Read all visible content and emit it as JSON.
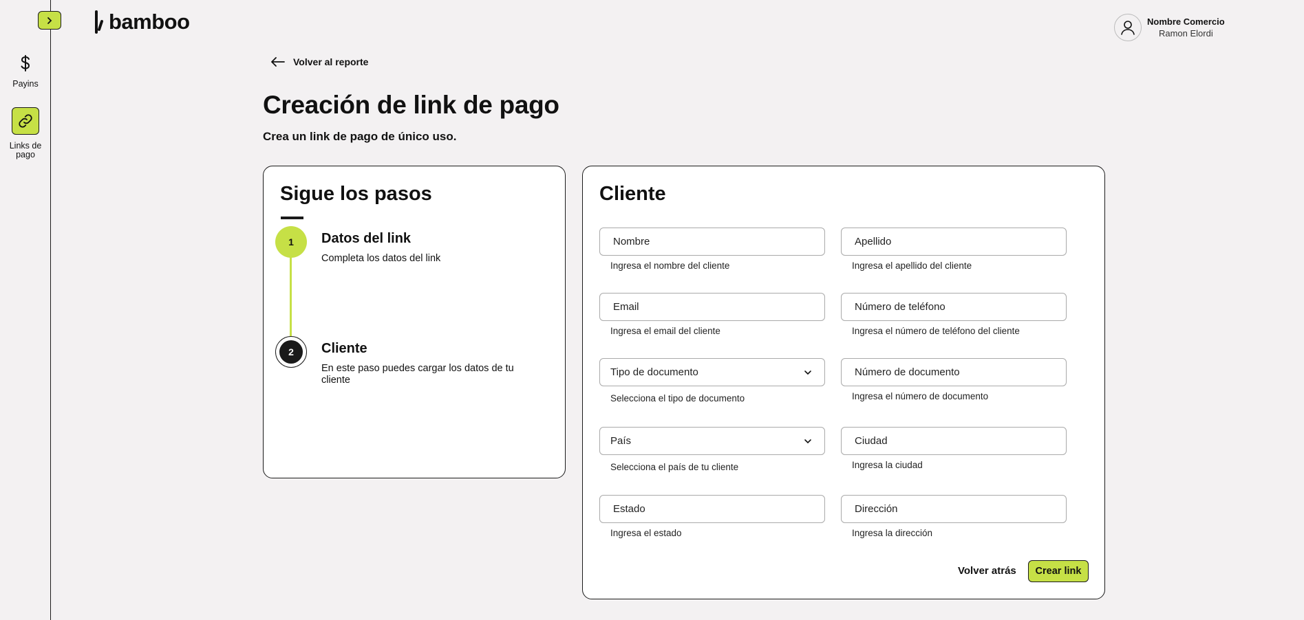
{
  "sidebar": {
    "toggle_icon": "chevron-right-icon",
    "items": [
      {
        "label": "Payins",
        "icon": "dollar-icon"
      },
      {
        "label": "Links de pago",
        "icon": "link-icon"
      }
    ]
  },
  "header": {
    "logo_text": "bamboo",
    "user": {
      "company": "Nombre Comercio",
      "name": "Ramon Elordi",
      "icon": "user-icon"
    }
  },
  "nav": {
    "back_label": "Volver al reporte"
  },
  "page": {
    "title": "Creación de link de pago",
    "subtitle": "Crea un link de pago de único uso."
  },
  "steps": {
    "title": "Sigue los pasos",
    "items": [
      {
        "number": "1",
        "title": "Datos del link",
        "description": "Completa los datos del link"
      },
      {
        "number": "2",
        "title": "Cliente",
        "description": "En este paso puedes cargar los datos de tu cliente"
      }
    ]
  },
  "client_form": {
    "title": "Cliente",
    "fields": [
      {
        "label": "Nombre",
        "hint": "Ingresa el nombre del cliente"
      },
      {
        "label": "Apellido",
        "hint": "Ingresa el apellido del cliente"
      },
      {
        "label": "Email",
        "hint": "Ingresa el email del cliente"
      },
      {
        "label": "Número de teléfono",
        "hint": "Ingresa el número de teléfono del cliente"
      },
      {
        "label": "Tipo de documento",
        "hint": "Selecciona el tipo de documento"
      },
      {
        "label": "Número de documento",
        "hint": "Ingresa el número de documento"
      },
      {
        "label": "País",
        "hint": "Selecciona el país de tu cliente"
      },
      {
        "label": "Ciudad",
        "hint": "Ingresa la ciudad"
      },
      {
        "label": "Estado",
        "hint": "Ingresa el estado"
      },
      {
        "label": "Dirección",
        "hint": "Ingresa la dirección"
      }
    ],
    "back_button": "Volver atrás",
    "create_button": "Crear link"
  },
  "colors": {
    "accent": "#c6e046",
    "background": "#f3f1f2",
    "border": "#1a1a1a"
  }
}
